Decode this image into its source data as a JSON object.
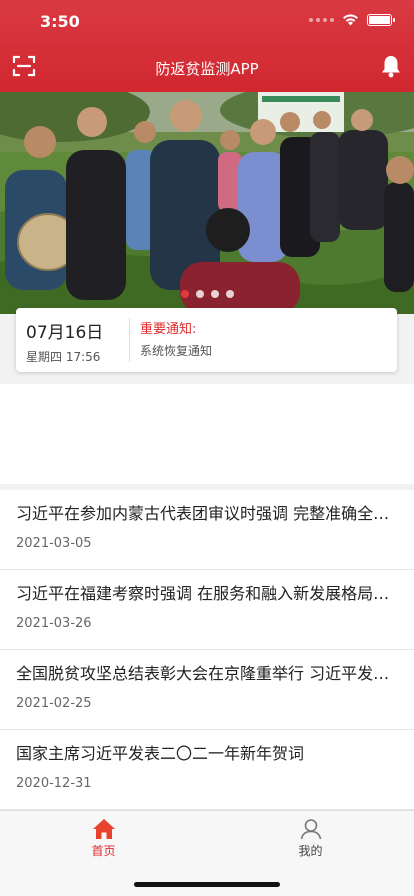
{
  "status_bar": {
    "time": "3:50"
  },
  "navbar": {
    "title": "防返贫监测APP"
  },
  "colors": {
    "brand_red": "#d1272f",
    "notice_red": "#e02a2a"
  },
  "banner": {
    "slide_count": 4,
    "active_index": 0
  },
  "notice": {
    "date": "07月16日",
    "weekday_time": "星期四 17:56",
    "title": "重要通知:",
    "body": "系统恢复通知"
  },
  "news": [
    {
      "title": "习近平在参加内蒙古代表团审议时强调 完整准确全面贯彻新发展理念",
      "date": "2021-03-05"
    },
    {
      "title": "习近平在福建考察时强调 在服务和融入新发展格局上展现更大作为",
      "date": "2021-03-26"
    },
    {
      "title": "全国脱贫攻坚总结表彰大会在京隆重举行 习近平发表重要讲话",
      "date": "2021-02-25"
    },
    {
      "title": "国家主席习近平发表二〇二一年新年贺词",
      "date": "2020-12-31"
    }
  ],
  "tabbar": {
    "home_label": "首页",
    "mine_label": "我的"
  },
  "icons": {
    "scan": "scan-icon",
    "bell": "bell-icon",
    "home": "home-icon",
    "user": "user-icon"
  }
}
